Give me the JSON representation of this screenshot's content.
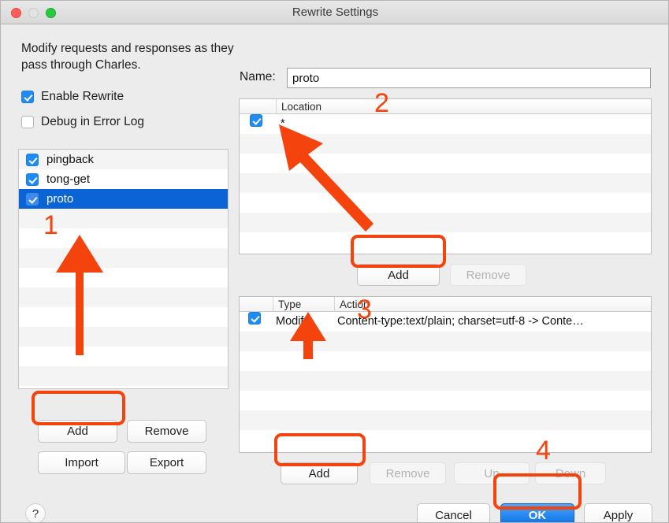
{
  "window": {
    "title": "Rewrite Settings",
    "traffic_lights": [
      "close-button",
      "minimize-button",
      "maximize-button"
    ]
  },
  "left": {
    "description": "Modify requests and responses as they pass through Charles.",
    "enable_rewrite": {
      "label": "Enable Rewrite",
      "checked": true
    },
    "debug_error_log": {
      "label": "Debug in Error Log",
      "checked": false
    },
    "rules": [
      {
        "label": "pingback",
        "checked": true,
        "selected": false
      },
      {
        "label": "tong-get",
        "checked": true,
        "selected": false
      },
      {
        "label": "proto",
        "checked": true,
        "selected": true
      }
    ],
    "buttons": {
      "add": "Add",
      "remove": "Remove",
      "import": "Import",
      "export": "Export"
    }
  },
  "right": {
    "name_label": "Name:",
    "name_value": "proto",
    "name_placeholder": "",
    "location_table": {
      "columns": [
        "",
        "Location"
      ],
      "rows": [
        {
          "checked": true,
          "location": "*"
        }
      ]
    },
    "location_buttons": {
      "add": "Add",
      "remove": "Remove",
      "remove_disabled": true
    },
    "action_table": {
      "columns": [
        "",
        "Type",
        "Action"
      ],
      "rows": [
        {
          "checked": true,
          "type": "Modify",
          "action": "Content-type:text/plain; charset=utf-8 -> Conte…"
        }
      ]
    },
    "action_buttons": {
      "add": "Add",
      "remove": "Remove",
      "up": "Up",
      "down": "Down",
      "remove_disabled": true,
      "up_disabled": true,
      "down_disabled": true
    }
  },
  "footer": {
    "help": "?",
    "cancel": "Cancel",
    "ok": "OK",
    "apply": "Apply"
  },
  "annotations": {
    "color": "#f4430d",
    "markers": [
      "1",
      "2",
      "3",
      "4"
    ]
  }
}
